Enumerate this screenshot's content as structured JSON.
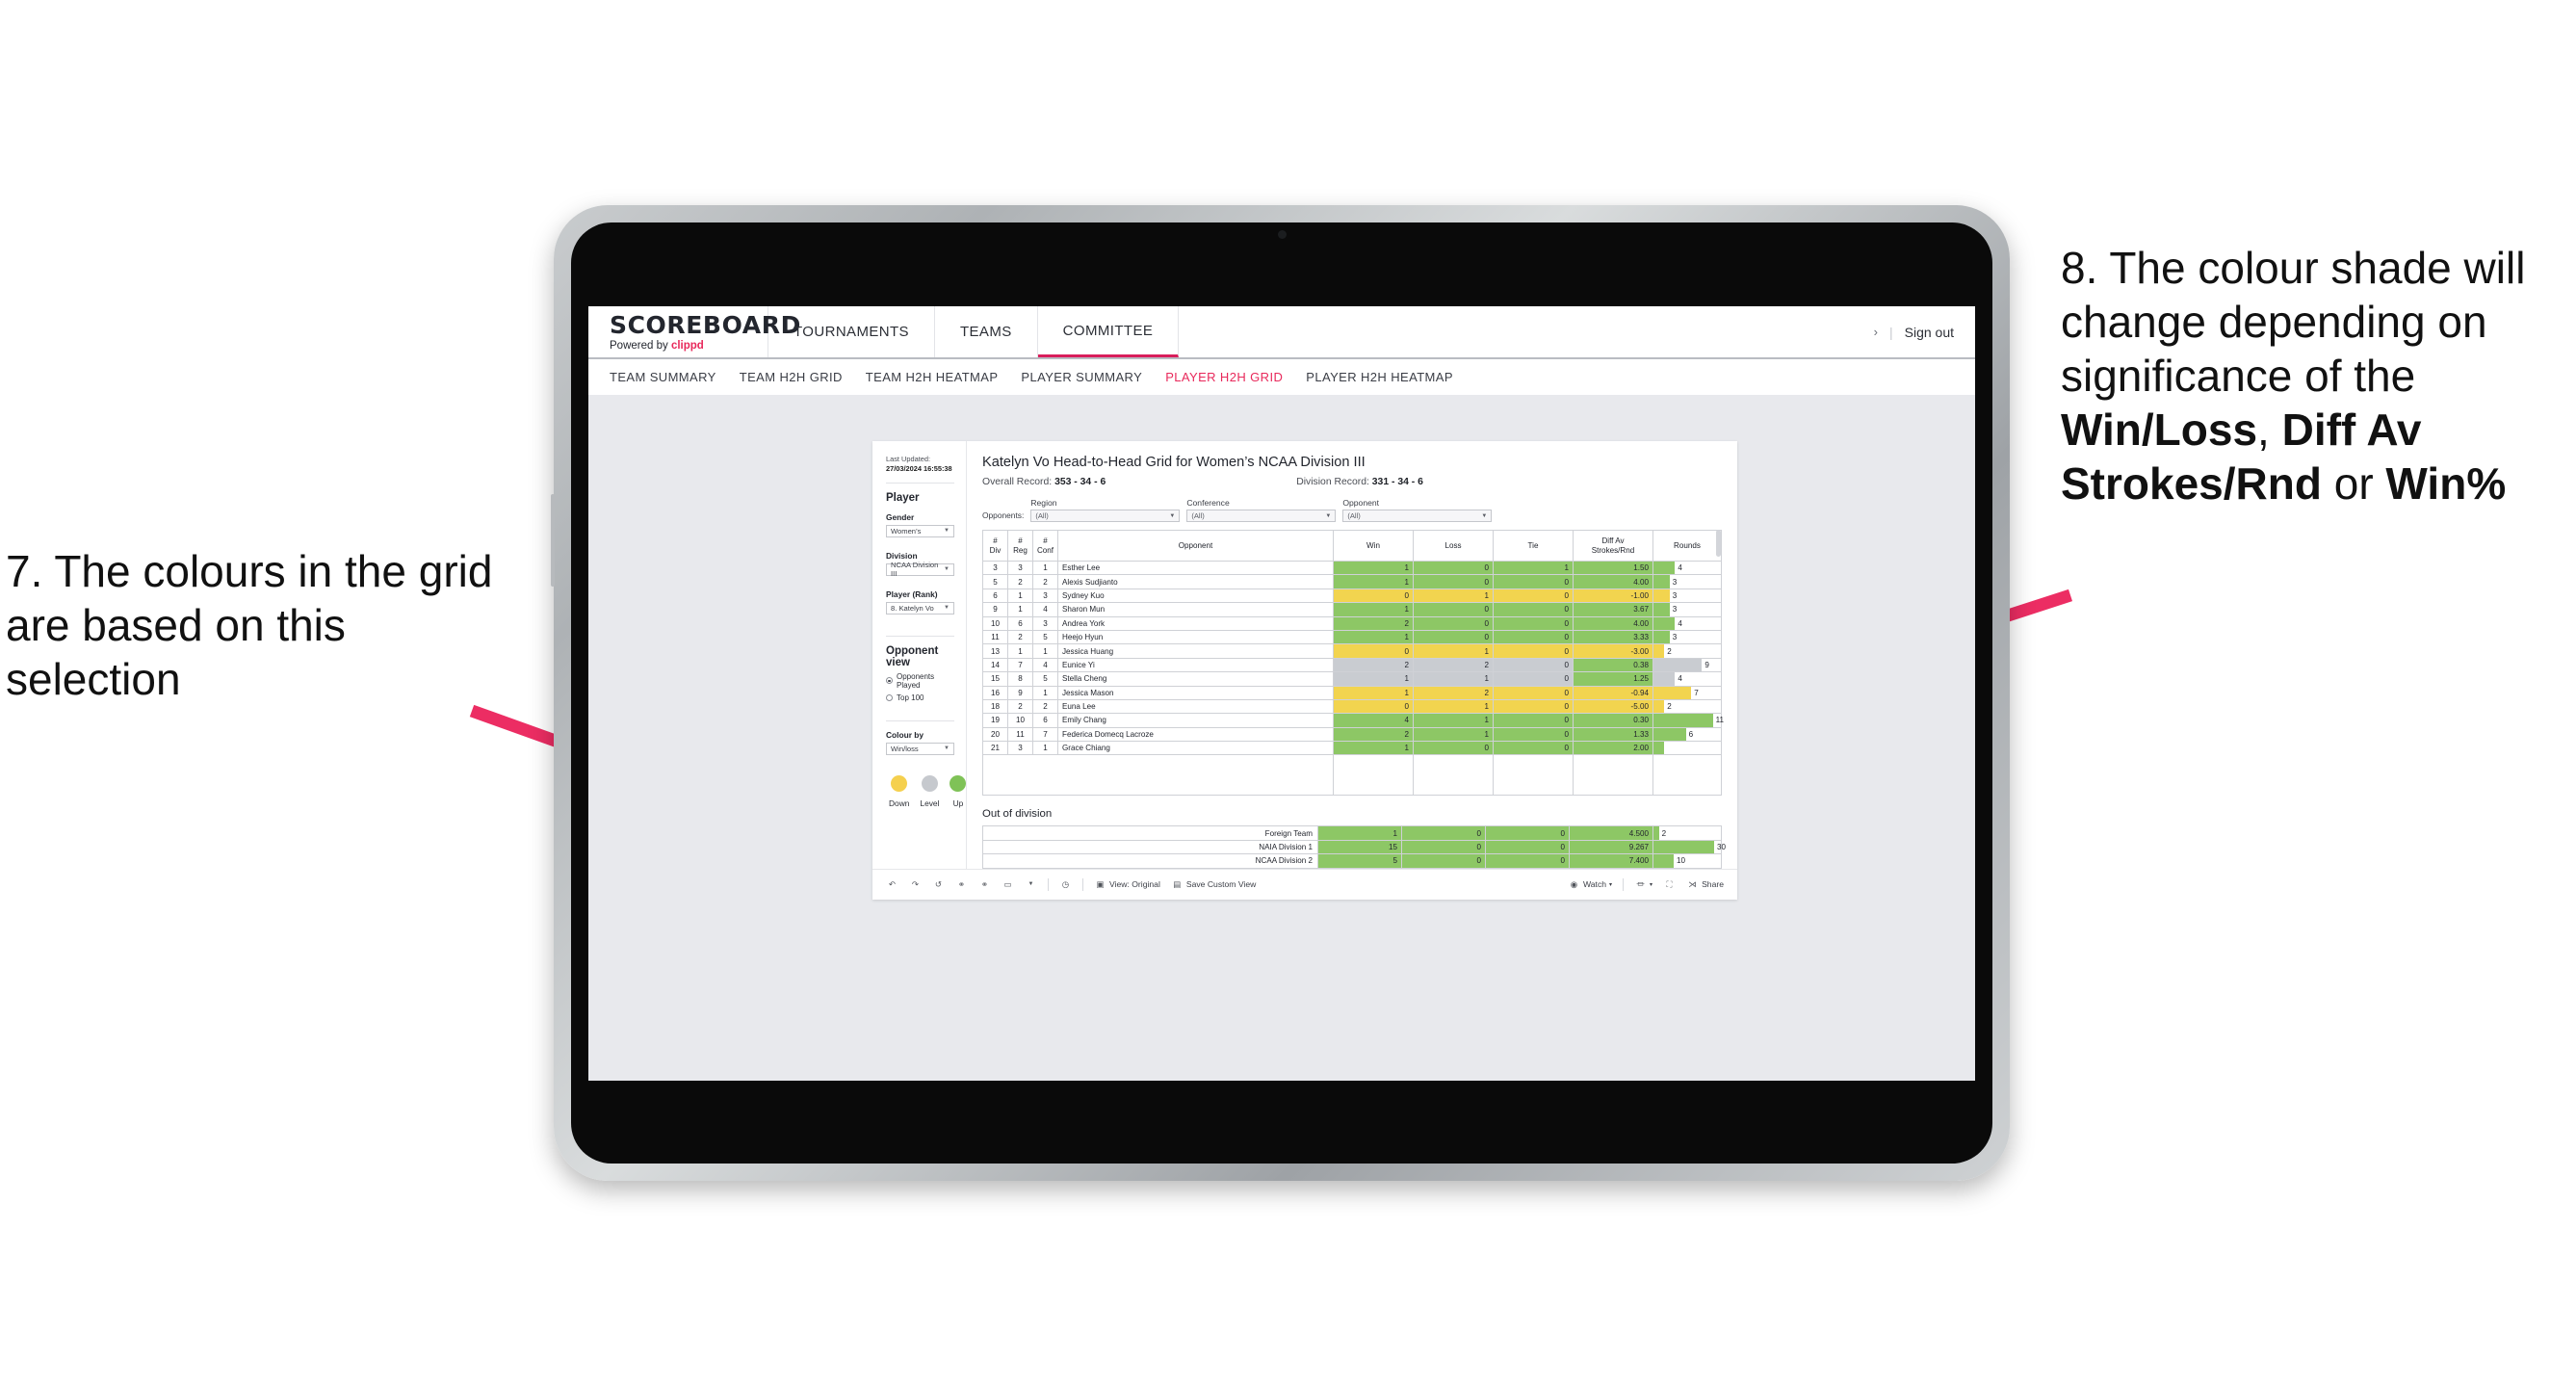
{
  "callouts": {
    "left": {
      "id": "7.",
      "text": "7. The colours in the grid are based on this selection"
    },
    "right": {
      "lead": "8. The colour shade will change depending on significance of the ",
      "b1": "Win/Loss",
      "mid1": ", ",
      "b2": "Diff Av Strokes/Rnd",
      "mid2": " or ",
      "b3": "Win%"
    },
    "arrow_color": "#EC2D63"
  },
  "app": {
    "brand": {
      "title": "SCOREBOARD",
      "powered": "Powered by",
      "vendor": "clippd"
    },
    "topnav": [
      {
        "label": "TOURNAMENTS",
        "active": false
      },
      {
        "label": "TEAMS",
        "active": false
      },
      {
        "label": "COMMITTEE",
        "active": true
      }
    ],
    "topbar_right": {
      "chevron": "›",
      "divider": "|",
      "signout": "Sign out"
    },
    "subnav": [
      {
        "label": "TEAM SUMMARY",
        "active": false
      },
      {
        "label": "TEAM H2H GRID",
        "active": false
      },
      {
        "label": "TEAM H2H HEATMAP",
        "active": false
      },
      {
        "label": "PLAYER SUMMARY",
        "active": false
      },
      {
        "label": "PLAYER H2H GRID",
        "active": true
      },
      {
        "label": "PLAYER H2H HEATMAP",
        "active": false
      }
    ]
  },
  "sidebar": {
    "last_updated_label": "Last Updated:",
    "last_updated_value": "27/03/2024 16:55:38",
    "player_heading": "Player",
    "fields": [
      {
        "label": "Gender",
        "value": "Women’s"
      },
      {
        "label": "Division",
        "value": "NCAA Division III"
      },
      {
        "label": "Player (Rank)",
        "value": "8. Katelyn Vo"
      }
    ],
    "opponent_view": {
      "heading": "Opponent view",
      "options": [
        {
          "label": "Opponents Played",
          "selected": true
        },
        {
          "label": "Top 100",
          "selected": false
        }
      ]
    },
    "colour_by": {
      "label": "Colour by",
      "value": "Win/loss"
    },
    "legend": [
      {
        "label": "Down",
        "color": "#F5D04E"
      },
      {
        "label": "Level",
        "color": "#C6C9CE"
      },
      {
        "label": "Up",
        "color": "#7FC257"
      }
    ]
  },
  "main": {
    "title": "Katelyn Vo Head-to-Head Grid for Women’s NCAA Division III",
    "overall_label": "Overall Record:",
    "overall_value": "353 - 34 - 6",
    "division_label": "Division Record:",
    "division_value": "331 - 34 - 6",
    "opponents_label": "Opponents:",
    "filters": [
      {
        "label": "Region",
        "value": "(All)"
      },
      {
        "label": "Conference",
        "value": "(All)"
      },
      {
        "label": "Opponent",
        "value": "(All)"
      }
    ],
    "columns": [
      "# Div",
      "# Reg",
      "# Conf",
      "Opponent",
      "Win",
      "Loss",
      "Tie",
      "Diff Av Strokes/Rnd",
      "Rounds"
    ],
    "rows": [
      {
        "div": "3",
        "reg": "3",
        "conf": "1",
        "opponent": "Esther Lee",
        "win": "1",
        "loss": "0",
        "tie": "1",
        "diff": "1.50",
        "rounds": "4",
        "color": "#8DC765"
      },
      {
        "div": "5",
        "reg": "2",
        "conf": "2",
        "opponent": "Alexis Sudjianto",
        "win": "1",
        "loss": "0",
        "tie": "0",
        "diff": "4.00",
        "rounds": "3",
        "color": "#8DC765"
      },
      {
        "div": "6",
        "reg": "1",
        "conf": "3",
        "opponent": "Sydney Kuo",
        "win": "0",
        "loss": "1",
        "tie": "0",
        "diff": "-1.00",
        "rounds": "3",
        "color": "#F2D44F"
      },
      {
        "div": "9",
        "reg": "1",
        "conf": "4",
        "opponent": "Sharon Mun",
        "win": "1",
        "loss": "0",
        "tie": "0",
        "diff": "3.67",
        "rounds": "3",
        "color": "#8DC765"
      },
      {
        "div": "10",
        "reg": "6",
        "conf": "3",
        "opponent": "Andrea York",
        "win": "2",
        "loss": "0",
        "tie": "0",
        "diff": "4.00",
        "rounds": "4",
        "color": "#8DC765"
      },
      {
        "div": "11",
        "reg": "2",
        "conf": "5",
        "opponent": "Heejo Hyun",
        "win": "1",
        "loss": "0",
        "tie": "0",
        "diff": "3.33",
        "rounds": "3",
        "color": "#8DC765"
      },
      {
        "div": "13",
        "reg": "1",
        "conf": "1",
        "opponent": "Jessica Huang",
        "win": "0",
        "loss": "1",
        "tie": "0",
        "diff": "-3.00",
        "rounds": "2",
        "color": "#F2D44F"
      },
      {
        "div": "14",
        "reg": "7",
        "conf": "4",
        "opponent": "Eunice Yi",
        "win": "2",
        "loss": "2",
        "tie": "0",
        "diff": "0.38",
        "rounds": "9",
        "color": "#C9CCD1",
        "diff_color": "#8DC765"
      },
      {
        "div": "15",
        "reg": "8",
        "conf": "5",
        "opponent": "Stella Cheng",
        "win": "1",
        "loss": "1",
        "tie": "0",
        "diff": "1.25",
        "rounds": "4",
        "color": "#C9CCD1",
        "diff_color": "#8DC765"
      },
      {
        "div": "16",
        "reg": "9",
        "conf": "1",
        "opponent": "Jessica Mason",
        "win": "1",
        "loss": "2",
        "tie": "0",
        "diff": "-0.94",
        "rounds": "7",
        "color": "#F2D44F"
      },
      {
        "div": "18",
        "reg": "2",
        "conf": "2",
        "opponent": "Euna Lee",
        "win": "0",
        "loss": "1",
        "tie": "0",
        "diff": "-5.00",
        "rounds": "2",
        "color": "#F2D44F"
      },
      {
        "div": "19",
        "reg": "10",
        "conf": "6",
        "opponent": "Emily Chang",
        "win": "4",
        "loss": "1",
        "tie": "0",
        "diff": "0.30",
        "rounds": "11",
        "color": "#8DC765"
      },
      {
        "div": "20",
        "reg": "11",
        "conf": "7",
        "opponent": "Federica Domecq Lacroze",
        "win": "2",
        "loss": "1",
        "tie": "0",
        "diff": "1.33",
        "rounds": "6",
        "color": "#8DC765"
      }
    ],
    "out_of_division": {
      "heading": "Out of division",
      "rows": [
        {
          "label": "Foreign Team",
          "win": "1",
          "loss": "0",
          "tie": "0",
          "diff": "4.500",
          "rounds": "2",
          "color": "#8DC765"
        },
        {
          "label": "NAIA Division 1",
          "win": "15",
          "loss": "0",
          "tie": "0",
          "diff": "9.267",
          "rounds": "30",
          "color": "#8DC765"
        },
        {
          "label": "NCAA Division 2",
          "win": "5",
          "loss": "0",
          "tie": "0",
          "diff": "7.400",
          "rounds": "10",
          "color": "#8DC765"
        }
      ]
    }
  },
  "toolbar": {
    "items": [
      {
        "name": "undo-icon",
        "glyph": "↶"
      },
      {
        "name": "redo-icon",
        "glyph": "↷"
      },
      {
        "name": "revert-icon",
        "glyph": "↺"
      },
      {
        "name": "refresh-data-icon",
        "glyph": "↻"
      },
      {
        "name": "pause-refresh-icon",
        "glyph": "⏸"
      },
      {
        "name": "highlight-icon",
        "glyph": "▭"
      },
      {
        "name": "highlight-dropdown-icon",
        "glyph": "▾"
      }
    ],
    "clock_icon": "◴",
    "view_label": "View: Original",
    "save_label": "Save Custom View",
    "watch_label": "Watch",
    "watch_caret": "▾",
    "download_caret": "▾",
    "share_label": "Share"
  }
}
